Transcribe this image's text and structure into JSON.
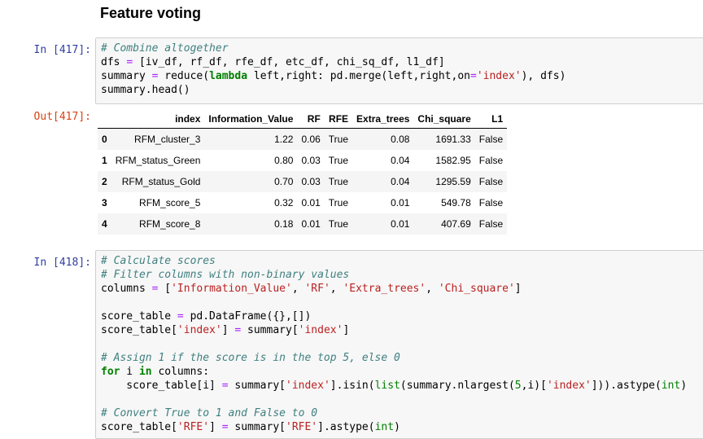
{
  "heading": "Feature voting",
  "cells": {
    "in417_prompt": "In [417]:",
    "out417_prompt": "Out[417]:",
    "in418_prompt": "In [418]:",
    "in417_code": [
      [
        [
          "cm",
          "# Combine altogether"
        ]
      ],
      [
        [
          "n",
          "dfs "
        ],
        [
          "op",
          "="
        ],
        [
          "n",
          " [iv_df, rf_df, rfe_df, etc_df, chi_sq_df, l1_df]"
        ]
      ],
      [
        [
          "n",
          "summary "
        ],
        [
          "op",
          "="
        ],
        [
          "n",
          " reduce("
        ],
        [
          "kw",
          "lambda"
        ],
        [
          "n",
          " left,right: pd.merge(left,right,on"
        ],
        [
          "op",
          "="
        ],
        [
          "st",
          "'index'"
        ],
        [
          "n",
          "), dfs)"
        ]
      ],
      [
        [
          "n",
          "summary.head()"
        ]
      ]
    ],
    "in418_code": [
      [
        [
          "cm",
          "# Calculate scores"
        ]
      ],
      [
        [
          "cm",
          "# Filter columns with non-binary values"
        ]
      ],
      [
        [
          "n",
          "columns "
        ],
        [
          "op",
          "="
        ],
        [
          "n",
          " ["
        ],
        [
          "st",
          "'Information_Value'"
        ],
        [
          "n",
          ", "
        ],
        [
          "st",
          "'RF'"
        ],
        [
          "n",
          ", "
        ],
        [
          "st",
          "'Extra_trees'"
        ],
        [
          "n",
          ", "
        ],
        [
          "st",
          "'Chi_square'"
        ],
        [
          "n",
          "]"
        ]
      ],
      [
        [
          "n",
          ""
        ]
      ],
      [
        [
          "n",
          "score_table "
        ],
        [
          "op",
          "="
        ],
        [
          "n",
          " pd.DataFrame({},[])"
        ]
      ],
      [
        [
          "n",
          "score_table["
        ],
        [
          "st",
          "'index'"
        ],
        [
          "n",
          "] "
        ],
        [
          "op",
          "="
        ],
        [
          "n",
          " summary["
        ],
        [
          "st",
          "'index'"
        ],
        [
          "n",
          "]"
        ]
      ],
      [
        [
          "n",
          ""
        ]
      ],
      [
        [
          "cm",
          "# Assign 1 if the score is in the top 5, else 0"
        ]
      ],
      [
        [
          "kw",
          "for"
        ],
        [
          "n",
          " i "
        ],
        [
          "kw",
          "in"
        ],
        [
          "n",
          " columns:"
        ]
      ],
      [
        [
          "n",
          "    score_table[i] "
        ],
        [
          "op",
          "="
        ],
        [
          "n",
          " summary["
        ],
        [
          "st",
          "'index'"
        ],
        [
          "n",
          "].isin("
        ],
        [
          "bi",
          "list"
        ],
        [
          "n",
          "(summary.nlargest("
        ],
        [
          "nu",
          "5"
        ],
        [
          "n",
          ",i)["
        ],
        [
          "st",
          "'index'"
        ],
        [
          "n",
          "])).astype("
        ],
        [
          "bi",
          "int"
        ],
        [
          "n",
          ")"
        ]
      ],
      [
        [
          "n",
          ""
        ]
      ],
      [
        [
          "cm",
          "# Convert True to 1 and False to 0"
        ]
      ],
      [
        [
          "n",
          "score_table["
        ],
        [
          "st",
          "'RFE'"
        ],
        [
          "n",
          "] "
        ],
        [
          "op",
          "="
        ],
        [
          "n",
          " summary["
        ],
        [
          "st",
          "'RFE'"
        ],
        [
          "n",
          "].astype("
        ],
        [
          "bi",
          "int"
        ],
        [
          "n",
          ")"
        ]
      ]
    ]
  },
  "table": {
    "columns": [
      "",
      "index",
      "Information_Value",
      "RF",
      "RFE",
      "Extra_trees",
      "Chi_square",
      "L1"
    ],
    "rows": [
      [
        "0",
        "RFM_cluster_3",
        "1.22",
        "0.06",
        "True",
        "0.08",
        "1691.33",
        "False"
      ],
      [
        "1",
        "RFM_status_Green",
        "0.80",
        "0.03",
        "True",
        "0.04",
        "1582.95",
        "False"
      ],
      [
        "2",
        "RFM_status_Gold",
        "0.70",
        "0.03",
        "True",
        "0.04",
        "1295.59",
        "False"
      ],
      [
        "3",
        "RFM_score_5",
        "0.32",
        "0.01",
        "True",
        "0.01",
        "549.78",
        "False"
      ],
      [
        "4",
        "RFM_score_8",
        "0.18",
        "0.01",
        "True",
        "0.01",
        "407.69",
        "False"
      ]
    ]
  }
}
